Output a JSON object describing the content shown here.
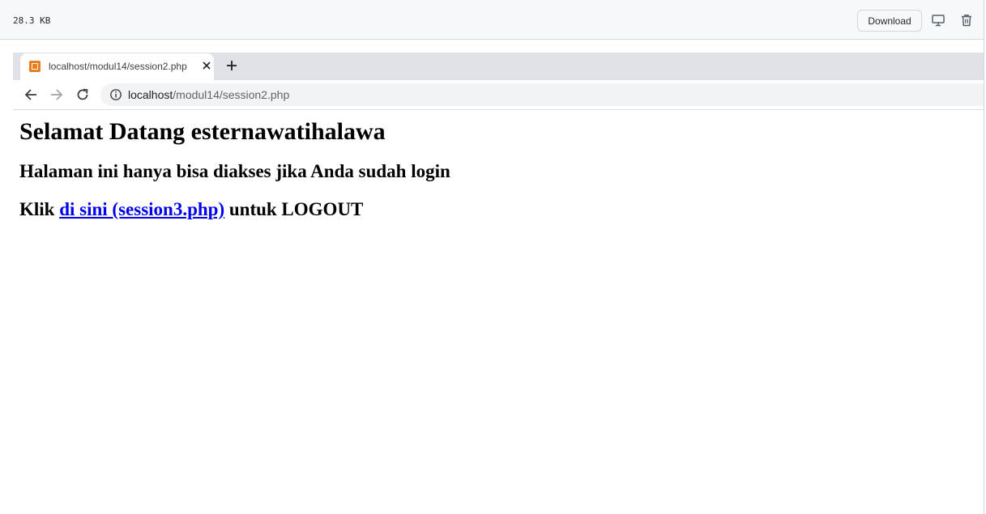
{
  "file_viewer": {
    "size": "28.3 KB",
    "download_label": "Download",
    "icons": [
      "desktop-icon",
      "trash-icon"
    ]
  },
  "browser": {
    "tab_title": "localhost/modul14/session2.php",
    "url_host": "localhost",
    "url_path": "/modul14/session2.php",
    "icons": [
      "favicon-icon",
      "close-icon",
      "plus-icon",
      "back-arrow-icon",
      "forward-arrow-icon",
      "reload-icon",
      "info-icon"
    ]
  },
  "page": {
    "heading": "Selamat Datang esternawatihalawa",
    "subheading": "Halaman ini hanya bisa diakses jika Anda sudah login",
    "logout_prefix": "Klik ",
    "logout_link": "di sini (session3.php)",
    "logout_suffix": " untuk LOGOUT"
  },
  "colors": {
    "link": "#0000ee",
    "tab_strip": "#dee1e6",
    "omnibox": "#f1f3f4",
    "favicon": "#e67e22"
  }
}
